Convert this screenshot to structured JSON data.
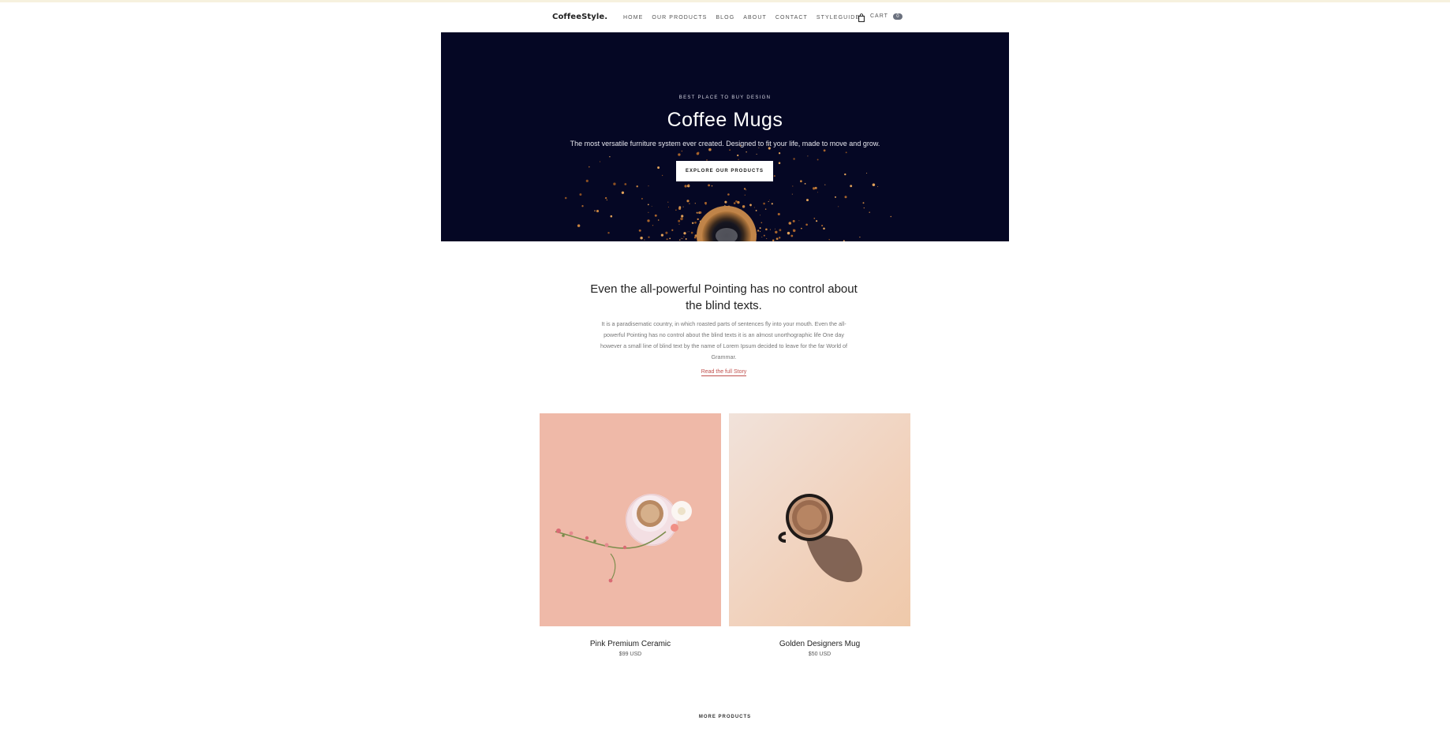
{
  "nav": {
    "brand": "CoffeeStyle.",
    "items": [
      {
        "label": "HOME"
      },
      {
        "label": "OUR PRODUCTS"
      },
      {
        "label": "BLOG"
      },
      {
        "label": "ABOUT"
      },
      {
        "label": "CONTACT"
      },
      {
        "label": "STYLEGUIDE"
      }
    ],
    "cart": {
      "label": "CART",
      "count": "0",
      "icon": "shopping-bag-icon"
    }
  },
  "hero": {
    "eyebrow": "BEST PLACE TO BUY DESIGN",
    "title": "Coffee Mugs",
    "subtitle": "The most versatile furniture system ever created. Designed to fit your life, made to move and grow.",
    "cta": "EXPLORE OUR PRODUCTS",
    "background": "#050724"
  },
  "story": {
    "heading": "Even the all-powerful Pointing has no control about the blind texts.",
    "body": "It is a paradisematic country, in which roasted parts of sentences fly into your mouth. Even the all-powerful Pointing has no control about the blind texts it is an almost unorthographic life One day however a small line of blind text by the name of Lorem Ipsum decided to leave for the far World of Grammar.",
    "link": "Read the full Story",
    "link_color": "#c0504d"
  },
  "products": [
    {
      "name": "Pink Premium Ceramic",
      "price": "$99 USD",
      "background": "#efb9a8"
    },
    {
      "name": "Golden Designers Mug",
      "price": "$50 USD",
      "background": "#f1d1bb"
    }
  ],
  "more_link": "MORE PRODUCTS"
}
